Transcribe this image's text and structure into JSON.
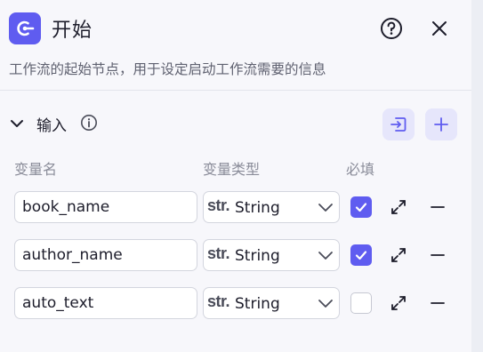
{
  "header": {
    "title": "开始",
    "description": "工作流的起始节点，用于设定启动工作流需要的信息"
  },
  "section": {
    "title": "输入"
  },
  "columns": {
    "name": "变量名",
    "type": "变量类型",
    "required": "必填"
  },
  "variables": [
    {
      "name": "book_name",
      "type_badge": "str.",
      "type": "String",
      "required": true
    },
    {
      "name": "author_name",
      "type_badge": "str.",
      "type": "String",
      "required": true
    },
    {
      "name": "auto_text",
      "type_badge": "str.",
      "type": "String",
      "required": false
    }
  ],
  "icons": {
    "node": "start-node-icon",
    "help": "help-circle-icon",
    "close": "close-icon",
    "collapse": "chevron-down-icon",
    "info": "info-icon",
    "import": "import-icon",
    "add": "plus-icon",
    "expand": "expand-icon",
    "remove": "minus-icon"
  },
  "colors": {
    "accent": "#5f5cf0",
    "accent_soft": "#e6e6fb",
    "background": "#f7f7fb"
  }
}
